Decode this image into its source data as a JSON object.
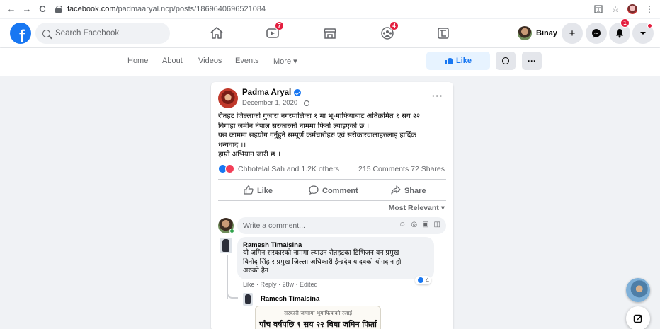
{
  "browser": {
    "url_domain": "facebook.com",
    "url_path": "/padmaaryal.ncp/posts/1869640696521084",
    "back_icon": "←",
    "forward_icon": "→",
    "reload_icon": "C"
  },
  "topbar": {
    "logo": "f",
    "search_placeholder": "Search Facebook",
    "watch_badge": "7",
    "groups_badge": "4",
    "profile_name": "Binay",
    "notifications_badge": "1",
    "accent_color": "#1877f2"
  },
  "page_nav": {
    "links": [
      "Home",
      "About",
      "Videos",
      "Events",
      "More ▾"
    ],
    "like_label": "Like",
    "more_label": "···"
  },
  "post": {
    "author": "Padma Aryal",
    "date": "December 1, 2020 ·",
    "body_lines": [
      "रौतहट जिल्लाको गुजारा नगरपालिका १ मा भू-माफियाबाट अतिक्रमित १ सय २२",
      "बिगाहा जमीन नेपाल सरकारको नाममा फिर्ता ल्याइएको छ ।",
      "यस काममा सहयोग गर्नुहुने सम्पूर्ण कर्मचारीहरु एवं सरोकारवालाहरुलाइ हार्दिक",
      "धन्यवाद ।।",
      "हाम्रो अभियान जारी छ ।"
    ],
    "reactions_text": "Chhotelal Sah and 1.2K others",
    "counts_text": "215 Comments 72 Shares",
    "actions": {
      "like": "Like",
      "comment": "Comment",
      "share": "Share"
    },
    "sort_label": "Most Relevant ▾",
    "comment_placeholder": "Write a comment..."
  },
  "comment": {
    "author": "Ramesh Timalsina",
    "text_lines": [
      "यो जमिन सरकारको नाममा ल्याउन रौतहटका डिभिजन वन प्रमुख",
      "बिनोद सिंह र प्रमुख जिल्ला अधिकारी ईन्द्रदेव यादवको योगदान हो",
      "अरुको हैन"
    ],
    "reaction_count": "4",
    "meta": "Like · Reply · 28w · Edited"
  },
  "reply": {
    "author": "Ramesh Timalsina",
    "image_line1": "सरकारी जग्गामा भूमाफियाको रजाई",
    "image_line2": "पाँच वर्षपछि १ सय २२ बिघा जमिन फिर्ता"
  }
}
